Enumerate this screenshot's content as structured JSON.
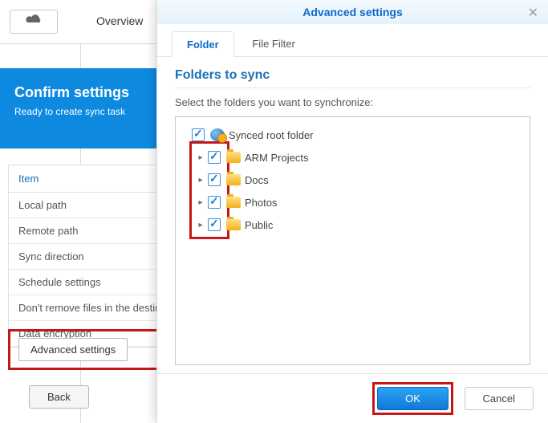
{
  "toolbar": {
    "overview_label": "Overview"
  },
  "banner": {
    "title": "Confirm settings",
    "subtitle": "Ready to create sync task"
  },
  "table": {
    "header": "Item",
    "rows": [
      "Local path",
      "Remote path",
      "Sync direction",
      "Schedule settings",
      "Don't remove files in the destination",
      "Data encryption"
    ]
  },
  "advanced_btn": "Advanced settings",
  "back_btn": "Back",
  "modal": {
    "title": "Advanced settings",
    "tabs": {
      "folder": "Folder",
      "filefilter": "File Filter"
    },
    "section_title": "Folders to sync",
    "instruction": "Select the folders you want to synchronize:",
    "root_label": "Synced root folder",
    "folders": [
      {
        "label": "ARM Projects"
      },
      {
        "label": "Docs"
      },
      {
        "label": "Photos"
      },
      {
        "label": "Public"
      }
    ],
    "ok": "OK",
    "cancel": "Cancel"
  }
}
